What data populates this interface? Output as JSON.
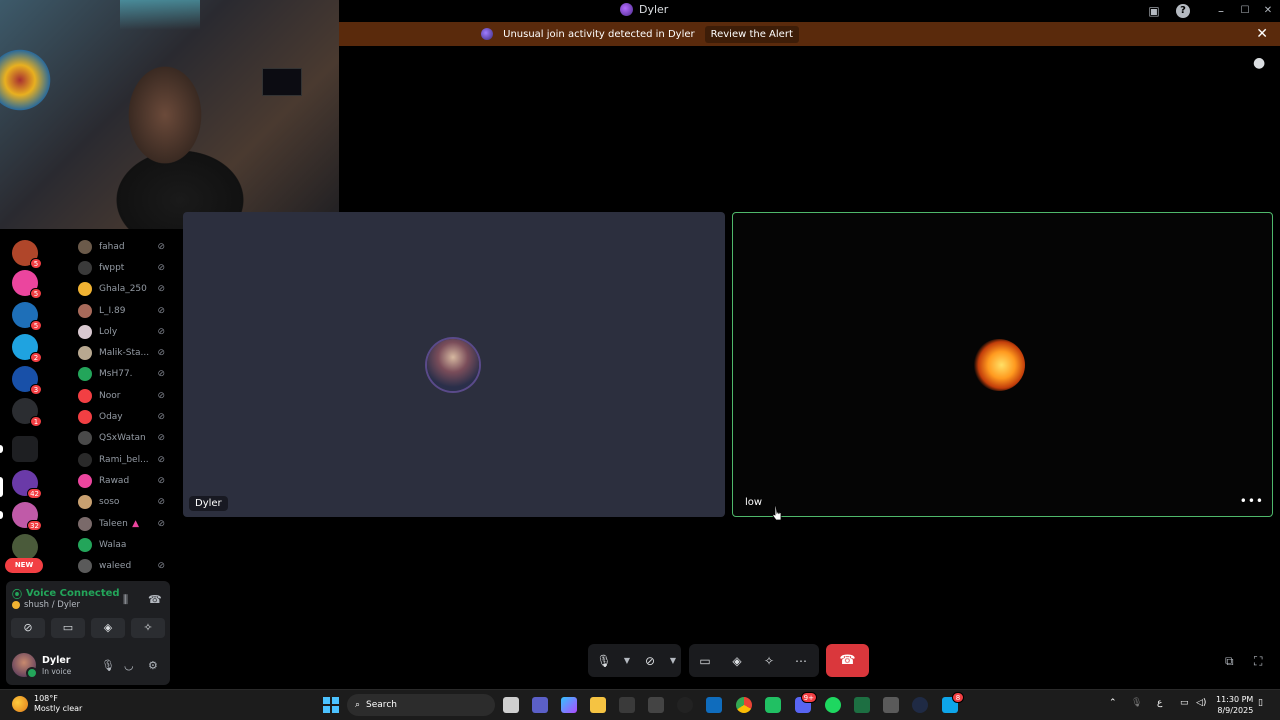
{
  "window": {
    "title": "Dyler",
    "controls": {
      "minimize": "–",
      "maximize": "☐",
      "close": "✕"
    }
  },
  "alert": {
    "message": "Unusual join activity detected in Dyler",
    "button": "Review the Alert"
  },
  "servers": [
    {
      "badge": "5",
      "color": "#b0462a"
    },
    {
      "badge": "5",
      "color": "#eb459e"
    },
    {
      "badge": "5",
      "color": "#1e6fb8"
    },
    {
      "badge": "2",
      "color": "#1fa3e0"
    },
    {
      "badge": "3",
      "color": "#1850a8"
    },
    {
      "badge": "1",
      "color": "#2b2d31"
    },
    {
      "badge": "",
      "color": "#1e1f22"
    },
    {
      "badge": "42",
      "color": "#6a3aa8"
    },
    {
      "badge": "32",
      "color": "#c05aa8"
    },
    {
      "badge": "",
      "color": "#4a5a3a"
    }
  ],
  "new_label": "NEW",
  "members": [
    {
      "name": "fahad",
      "color": "#6b5a4a"
    },
    {
      "name": "fwppt",
      "color": "#3a3a3a"
    },
    {
      "name": "Ghala_250",
      "color": "#f0b232"
    },
    {
      "name": "L_I.89",
      "color": "#a86a5a"
    },
    {
      "name": "Loly",
      "color": "#d8c8d0"
    },
    {
      "name": "Malik-Sta...",
      "color": "#b8a890"
    },
    {
      "name": "MsH77.",
      "color": "#23a55a"
    },
    {
      "name": "Noor",
      "color": "#f23f43"
    },
    {
      "name": "Oday",
      "color": "#f23f43"
    },
    {
      "name": "QSxWatan",
      "color": "#4a4a4a"
    },
    {
      "name": "Rami_bel...",
      "color": "#2a2a2a"
    },
    {
      "name": "Rawad",
      "color": "#eb459e"
    },
    {
      "name": "soso",
      "color": "#c8a070"
    },
    {
      "name": "Taleen",
      "color": "#7a6a6a"
    },
    {
      "name": "Walaa",
      "color": "#23a55a"
    },
    {
      "name": "waleed",
      "color": "#5a5a5a"
    }
  ],
  "voice": {
    "status": "Voice Connected",
    "channel": "shush / Dyler"
  },
  "user": {
    "name": "Dyler",
    "status": "In voice"
  },
  "tiles": [
    {
      "name": "Dyler"
    },
    {
      "name": "low"
    }
  ],
  "taskbar": {
    "weather_temp": "108°F",
    "weather_desc": "Mostly clear",
    "search_placeholder": "Search",
    "time": "11:30 PM",
    "date": "8/9/2025",
    "lang": "ع",
    "discord_badge": "9+",
    "store_badge": "8"
  },
  "colors": {
    "accent_green": "#23a55a",
    "danger": "#da373c",
    "alert_bg": "#5a2a0c"
  }
}
